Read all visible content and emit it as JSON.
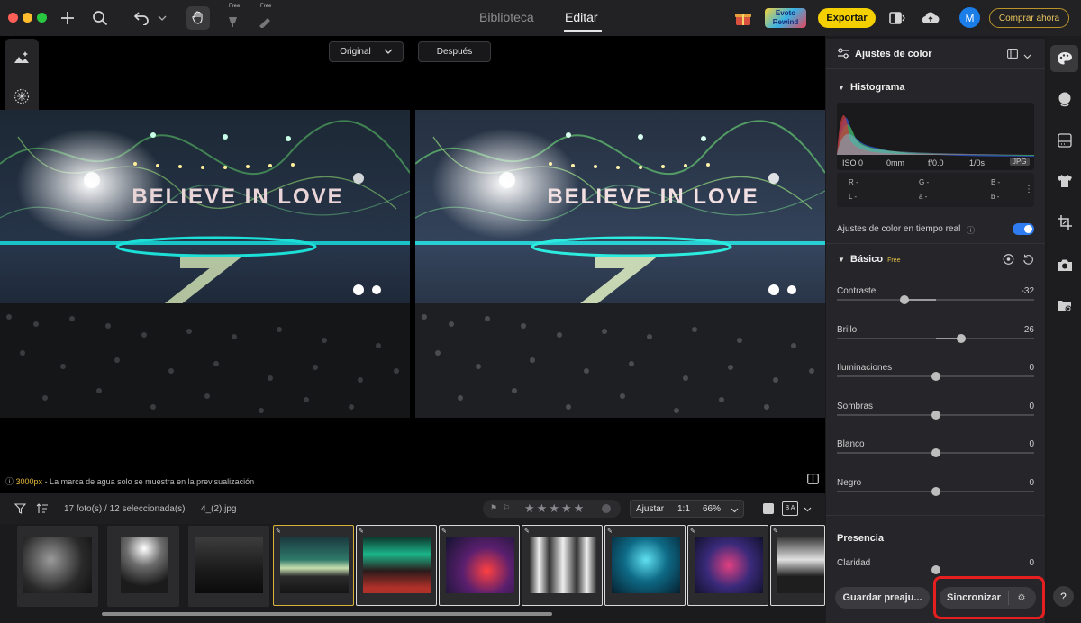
{
  "topbar": {
    "free1": "Free",
    "free2": "Free",
    "tab_library": "Biblioteca",
    "tab_edit": "Editar",
    "rewind_line1": "Evoto",
    "rewind_line2": "Rewind",
    "export_label": "Exportar",
    "avatar_initial": "M",
    "buy_label": "Comprar ahora"
  },
  "canvas": {
    "original_label": "Original",
    "after_label": "Después",
    "watermark_px": "3000px",
    "watermark_text": " - La marca de agua solo se muestra en la previsualización",
    "photo_text": "BELIEVE IN LOVE"
  },
  "filmstrip": {
    "count_label": "17 foto(s) / 12 seleccionada(s)",
    "filename": "4_(2).jpg",
    "fit_label": "Ajustar",
    "ratio_label": "1:1",
    "zoom_label": "66%",
    "ba_label": "B A",
    "rating_stars": 5,
    "scroll_position": 0.25
  },
  "panel": {
    "header_title": "Ajustes de color",
    "histogram_title": "Histograma",
    "exif": {
      "iso": "ISO 0",
      "focal": "0mm",
      "aperture": "f/0.0",
      "shutter": "1/0s",
      "format": "JPG"
    },
    "rgb": {
      "r1": "R -",
      "g1": "G -",
      "b1": "B -",
      "l": "L -",
      "a": "a -",
      "b2": "b -"
    },
    "realtime_label": "Ajustes de color en tiempo real",
    "realtime_on": true,
    "basic_title": "Básico",
    "basic_badge": "Free",
    "presence_title": "Presencia",
    "sliders": [
      {
        "label": "Contraste",
        "value": "-32",
        "fraction": -0.32
      },
      {
        "label": "Brillo",
        "value": "26",
        "fraction": 0.26
      },
      {
        "label": "Iluminaciones",
        "value": "0",
        "fraction": 0
      },
      {
        "label": "Sombras",
        "value": "0",
        "fraction": 0
      },
      {
        "label": "Blanco",
        "value": "0",
        "fraction": 0
      },
      {
        "label": "Negro",
        "value": "0",
        "fraction": 0
      },
      {
        "label": "Claridad",
        "value": "0",
        "fraction": 0
      }
    ],
    "save_preset_label": "Guardar preaju...",
    "sync_label": "Sincronizar",
    "help_label": "?"
  },
  "colors": {
    "accent_yellow": "#f4d000",
    "toggle_blue": "#2e7cf0",
    "highlight_red": "#e51f1f",
    "active_thumb_border": "#d8b33c"
  },
  "icons": {
    "top": [
      "plus-icon",
      "search-icon",
      "undo-icon",
      "hand-icon",
      "eraser-icon",
      "brush-icon",
      "gift-icon",
      "compare-window-icon",
      "cloud-icon"
    ],
    "left_tools": [
      "landscape-edit-icon",
      "texture-icon",
      "history-clock-icon"
    ],
    "right_rail": [
      "palette-icon",
      "face-icon",
      "pattern-icon",
      "shirt-icon",
      "crop-icon",
      "camera-icon",
      "folder-sync-icon"
    ]
  }
}
